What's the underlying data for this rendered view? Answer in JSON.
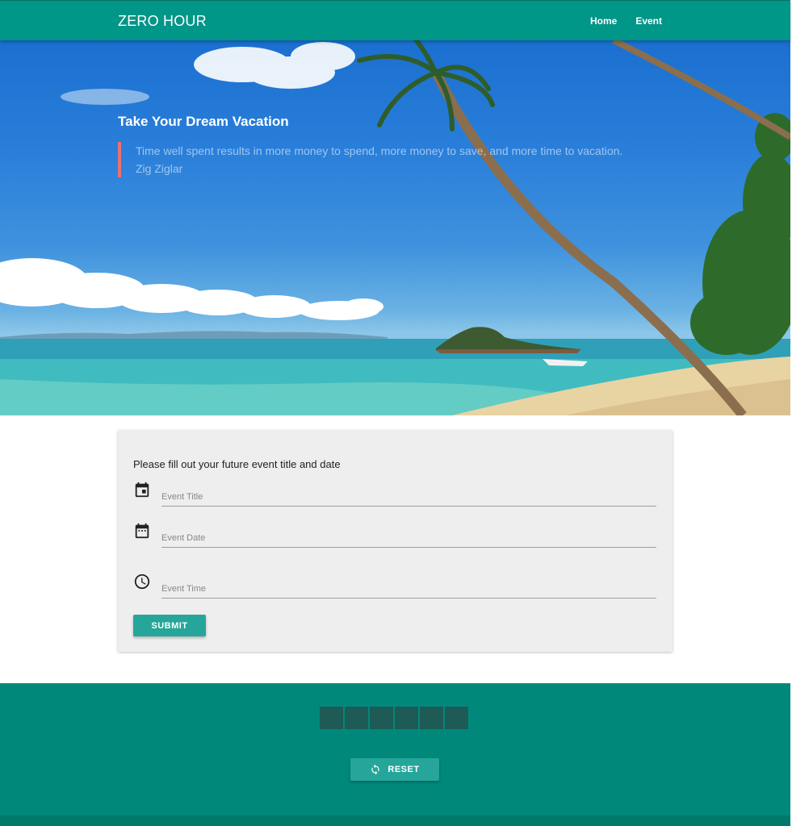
{
  "nav": {
    "brand": "ZERO HOUR",
    "links": [
      "Home",
      "Event"
    ]
  },
  "hero": {
    "title": "Take Your Dream Vacation",
    "quote": "Time well spent results in more money to spend, more money to save, and more time to vacation.",
    "author": "Zig Ziglar"
  },
  "form": {
    "intro": "Please fill out your future event title and date",
    "fields": [
      {
        "icon": "calendar-event-icon",
        "placeholder": "Event Title",
        "value": ""
      },
      {
        "icon": "calendar-date-icon",
        "placeholder": "Event Date",
        "value": ""
      },
      {
        "icon": "clock-icon",
        "placeholder": "Event Time",
        "value": ""
      }
    ],
    "submit_label": "SUBMIT"
  },
  "footer": {
    "countdown_digits": [
      "",
      "",
      "",
      "",
      "",
      ""
    ],
    "reset_label": "RESET",
    "reset_icon": "refresh-icon"
  },
  "colors": {
    "primary": "#009688",
    "button": "#26a69a",
    "footer": "#00897b",
    "quote_border": "#e57373"
  }
}
